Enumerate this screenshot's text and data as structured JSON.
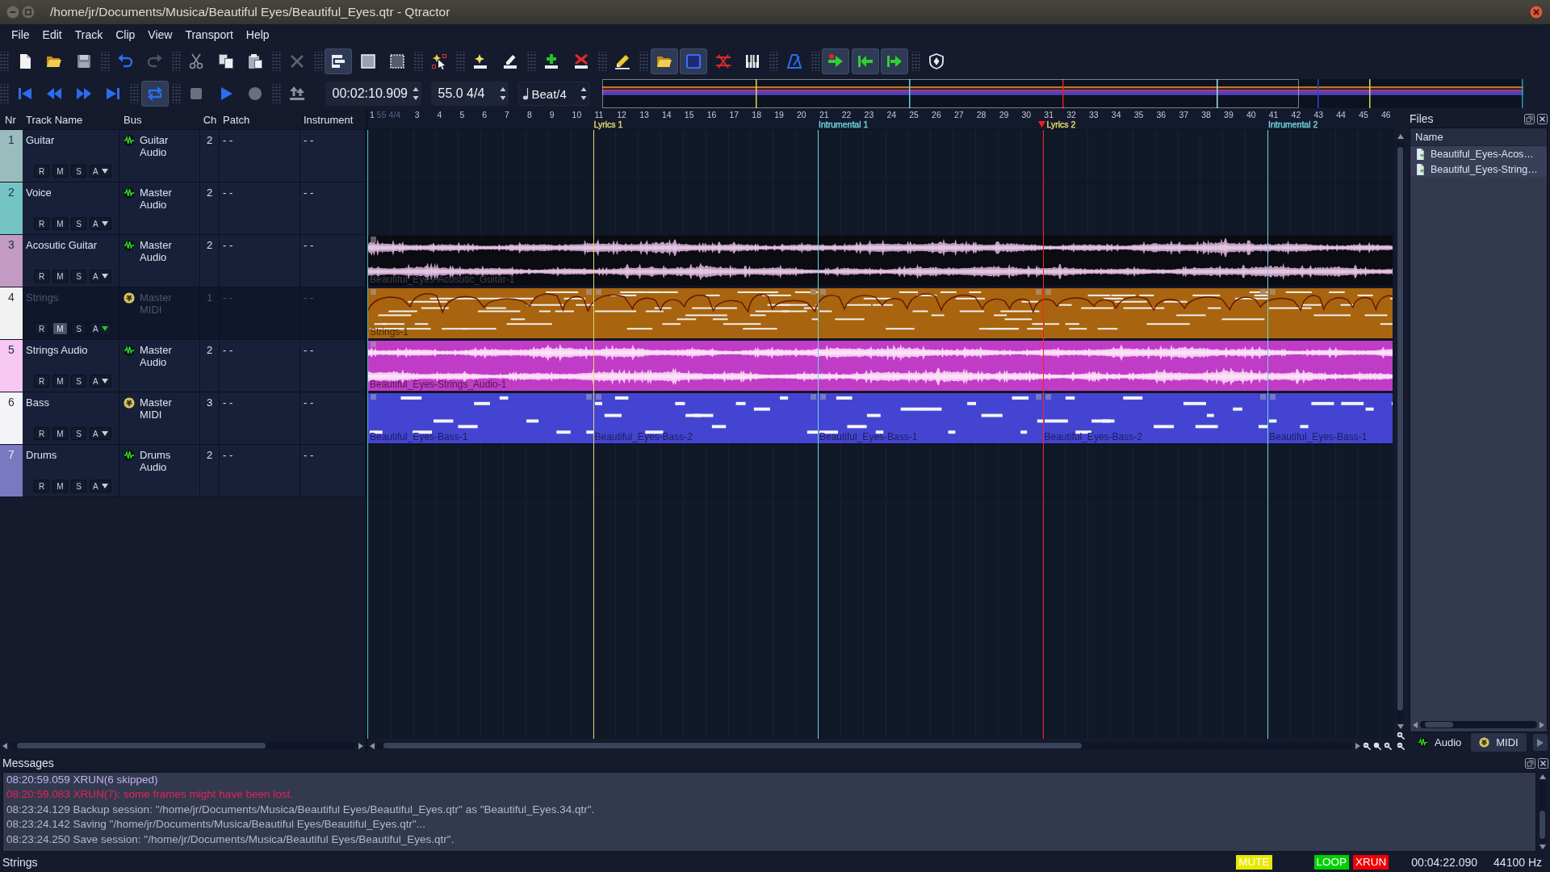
{
  "window": {
    "title": "/home/jr/Documents/Musica/Beautiful Eyes/Beautiful_Eyes.qtr - Qtractor"
  },
  "menu": [
    "File",
    "Edit",
    "Track",
    "Clip",
    "View",
    "Transport",
    "Help"
  ],
  "toolbar": [
    [
      {
        "kind": "new",
        "on": false
      },
      {
        "kind": "open",
        "on": false
      },
      {
        "kind": "save",
        "on": false
      }
    ],
    [
      {
        "kind": "undo",
        "on": false
      },
      {
        "kind": "redo",
        "on": false
      }
    ],
    [
      {
        "kind": "cut",
        "on": false
      },
      {
        "kind": "copy",
        "on": false
      },
      {
        "kind": "paste",
        "on": false
      }
    ],
    [
      {
        "kind": "delete",
        "on": false
      }
    ],
    [
      {
        "kind": "track_view",
        "on": true
      },
      {
        "kind": "select_clip",
        "on": false
      },
      {
        "kind": "select_range",
        "on": false
      }
    ],
    [
      {
        "kind": "select_tool",
        "on": false
      }
    ],
    [
      {
        "kind": "add_track",
        "on": false
      },
      {
        "kind": "edit_track",
        "on": false
      }
    ],
    [
      {
        "kind": "add_clip",
        "on": false
      },
      {
        "kind": "remove_clip",
        "on": false
      }
    ],
    [
      {
        "kind": "pencil",
        "on": false
      }
    ],
    [
      {
        "kind": "files",
        "on": true
      },
      {
        "kind": "connections",
        "on": true
      },
      {
        "kind": "crossed",
        "on": false
      },
      {
        "kind": "keys",
        "on": false
      }
    ],
    [
      {
        "kind": "metronome",
        "on": false
      }
    ],
    [
      {
        "kind": "follow",
        "on": true
      },
      {
        "kind": "punch_in",
        "on": true
      },
      {
        "kind": "punch_out",
        "on": true
      }
    ],
    [
      {
        "kind": "shield",
        "on": false
      }
    ]
  ],
  "transport": {
    "buttons": [
      [
        {
          "kind": "first",
          "on": false
        },
        {
          "kind": "rewind",
          "on": false
        },
        {
          "kind": "forward",
          "on": false
        },
        {
          "kind": "last",
          "on": false
        }
      ],
      [
        {
          "kind": "loop",
          "on": true
        }
      ],
      [
        {
          "kind": "stop",
          "on": false
        },
        {
          "kind": "play",
          "on": false
        },
        {
          "kind": "record",
          "on": false
        }
      ],
      [
        {
          "kind": "punch",
          "on": false
        }
      ]
    ],
    "time": "00:02:10.909",
    "tempo": "55.0 4/4",
    "snap": "Beat/4"
  },
  "track_list": {
    "columns": [
      "Nr",
      "Track Name",
      "Bus",
      "Ch",
      "Patch",
      "Instrument"
    ],
    "tracks": [
      {
        "nr": "1",
        "name": "Guitar",
        "color": "#9bbcbc",
        "selected": false,
        "buttons": [
          "R",
          "M",
          "S",
          "A"
        ],
        "muted": false,
        "automation": false,
        "bus": {
          "kind": "audio",
          "label": "Guitar Audio"
        },
        "ch": "2",
        "patch": "- -",
        "instrument": "- -"
      },
      {
        "nr": "2",
        "name": "Voice",
        "color": "#74c4c4",
        "selected": false,
        "buttons": [
          "R",
          "M",
          "S",
          "A"
        ],
        "muted": false,
        "automation": false,
        "bus": {
          "kind": "audio",
          "label": "Master Audio"
        },
        "ch": "2",
        "patch": "- -",
        "instrument": "- -"
      },
      {
        "nr": "3",
        "name": "Acosutic Guitar",
        "color": "#c29ac2",
        "selected": false,
        "buttons": [
          "R",
          "M",
          "S",
          "A"
        ],
        "muted": false,
        "automation": false,
        "bus": {
          "kind": "audio",
          "label": "Master Audio"
        },
        "ch": "2",
        "patch": "- -",
        "instrument": "- -",
        "clips": [
          {
            "kind": "audio",
            "color": "#0b0b12",
            "label": "Beautiful_Eyes-Acosutic_Guitar-1"
          }
        ]
      },
      {
        "nr": "4",
        "name": "Strings",
        "color": "#f2f2f2",
        "selected": true,
        "buttons": [
          "R",
          "M",
          "S",
          "A"
        ],
        "muted": true,
        "automation": true,
        "bus": {
          "kind": "midi",
          "label": "Master MIDI"
        },
        "ch": "1",
        "patch": "- -",
        "instrument": "- -",
        "clips": [
          {
            "kind": "midi",
            "color": "#a8640e",
            "label": "Strings-1"
          },
          {
            "kind": "midi",
            "color": "#a8640e"
          },
          {
            "kind": "midi",
            "color": "#a8640e"
          },
          {
            "kind": "midi",
            "color": "#a8640e"
          },
          {
            "kind": "midi",
            "color": "#a8640e"
          }
        ]
      },
      {
        "nr": "5",
        "name": "Strings Audio",
        "color": "#f6c8f2",
        "selected": false,
        "buttons": [
          "R",
          "M",
          "S",
          "A"
        ],
        "muted": false,
        "automation": false,
        "bus": {
          "kind": "audio",
          "label": "Master Audio"
        },
        "ch": "2",
        "patch": "- -",
        "instrument": "- -",
        "clips": [
          {
            "kind": "audio",
            "color": "#c03cc6",
            "label": "Beautiful_Eyes-Strings_Audio-1"
          }
        ]
      },
      {
        "nr": "6",
        "name": "Bass",
        "color": "#f4f4f8",
        "selected": false,
        "buttons": [
          "R",
          "M",
          "S",
          "A"
        ],
        "muted": false,
        "automation": false,
        "bus": {
          "kind": "midi",
          "label": "Master MIDI"
        },
        "ch": "3",
        "patch": "- -",
        "instrument": "- -",
        "clips": [
          {
            "kind": "midi",
            "color": "#4444d2",
            "label": "Beautiful_Eyes-Bass-1"
          },
          {
            "kind": "midi",
            "color": "#4444d2",
            "label": "Beautiful_Eyes-Bass-2"
          },
          {
            "kind": "midi",
            "color": "#4444d2",
            "label": "Beautiful_Eyes-Bass-1"
          },
          {
            "kind": "midi",
            "color": "#4444d2",
            "label": "Beautiful_Eyes-Bass-2"
          },
          {
            "kind": "midi",
            "color": "#4444d2",
            "label": "Beautiful_Eyes-Bass-1"
          }
        ]
      },
      {
        "nr": "7",
        "name": "Drums",
        "color": "#7a78c0",
        "selected": false,
        "buttons": [
          "R",
          "M",
          "S",
          "A"
        ],
        "muted": false,
        "automation": false,
        "bus": {
          "kind": "audio",
          "label": "Drums Audio"
        },
        "ch": "2",
        "patch": "- -",
        "instrument": "- -"
      }
    ]
  },
  "timeline": {
    "ruler": [
      {
        "kind": "bar",
        "label": "1"
      },
      {
        "kind": "tempo",
        "label": "55 4/4"
      },
      {
        "kind": "bar",
        "label": "3"
      },
      {
        "kind": "bar",
        "label": "4"
      },
      {
        "kind": "bar",
        "label": "5"
      },
      {
        "kind": "bar",
        "label": "6"
      },
      {
        "kind": "bar",
        "label": "7"
      },
      {
        "kind": "bar",
        "label": "8"
      },
      {
        "kind": "bar",
        "label": "9"
      },
      {
        "kind": "bar",
        "label": "10"
      },
      {
        "kind": "bar",
        "label": "11",
        "marker": {
          "label": "Lyrics 1",
          "color": "#e2d86a",
          "playhead": false
        }
      },
      {
        "kind": "bar",
        "label": "12"
      },
      {
        "kind": "bar",
        "label": "13"
      },
      {
        "kind": "bar",
        "label": "14"
      },
      {
        "kind": "bar",
        "label": "15"
      },
      {
        "kind": "bar",
        "label": "16"
      },
      {
        "kind": "bar",
        "label": "17"
      },
      {
        "kind": "bar",
        "label": "18"
      },
      {
        "kind": "bar",
        "label": "19"
      },
      {
        "kind": "bar",
        "label": "20"
      },
      {
        "kind": "bar",
        "label": "21",
        "marker": {
          "label": "Intrumental 1",
          "color": "#6fd3dd",
          "playhead": false
        }
      },
      {
        "kind": "bar",
        "label": "22"
      },
      {
        "kind": "bar",
        "label": "23"
      },
      {
        "kind": "bar",
        "label": "24"
      },
      {
        "kind": "bar",
        "label": "25"
      },
      {
        "kind": "bar",
        "label": "26"
      },
      {
        "kind": "bar",
        "label": "27"
      },
      {
        "kind": "bar",
        "label": "28"
      },
      {
        "kind": "bar",
        "label": "29"
      },
      {
        "kind": "bar",
        "label": "30"
      },
      {
        "kind": "bar",
        "label": "31",
        "marker": {
          "label": "Lyrics 2",
          "color": "#e2d86a",
          "playhead": true
        }
      },
      {
        "kind": "bar",
        "label": "32"
      },
      {
        "kind": "bar",
        "label": "33"
      },
      {
        "kind": "bar",
        "label": "34"
      },
      {
        "kind": "bar",
        "label": "35"
      },
      {
        "kind": "bar",
        "label": "36"
      },
      {
        "kind": "bar",
        "label": "37"
      },
      {
        "kind": "bar",
        "label": "38"
      },
      {
        "kind": "bar",
        "label": "39"
      },
      {
        "kind": "bar",
        "label": "40"
      },
      {
        "kind": "bar",
        "label": "41",
        "marker": {
          "label": "Intrumental 2",
          "color": "#6fd3dd",
          "playhead": false
        }
      },
      {
        "kind": "bar",
        "label": "42"
      },
      {
        "kind": "bar",
        "label": "43"
      },
      {
        "kind": "bar",
        "label": "44"
      },
      {
        "kind": "bar",
        "label": "45"
      },
      {
        "kind": "bar",
        "label": "46"
      }
    ]
  },
  "files": {
    "title": "Files",
    "column": "Name",
    "items": [
      "Beautiful_Eyes-Acos…",
      "Beautiful_Eyes-String…"
    ],
    "tabs": [
      {
        "kind": "audio",
        "label": "Audio",
        "selected": true
      },
      {
        "kind": "midi",
        "label": "MIDI",
        "selected": false
      }
    ]
  },
  "messages": {
    "title": "Messages",
    "lines": [
      {
        "text": "08:20:59.059 XRUN(6 skipped)",
        "color": "#c4aef0"
      },
      {
        "text": "08:20:59.083 XRUN(7): some frames might have been lost.",
        "color": "#e8205a"
      },
      {
        "text": "08:23:24.129 Backup session: \"/home/jr/Documents/Musica/Beautiful Eyes/Beautiful_Eyes.qtr\" as \"Beautiful_Eyes.34.qtr\".",
        "color": "#b4b8c6"
      },
      {
        "text": "08:23:24.142 Saving \"/home/jr/Documents/Musica/Beautiful Eyes/Beautiful_Eyes.qtr\"...",
        "color": "#b4b8c6"
      },
      {
        "text": "08:23:24.250 Save session: \"/home/jr/Documents/Musica/Beautiful Eyes/Beautiful_Eyes.qtr\".",
        "color": "#b4b8c6"
      }
    ]
  },
  "status_bar": {
    "text": "Strings",
    "indicators": [
      {
        "label": "MUTE",
        "color": "#e8e800"
      },
      {
        "label": "LOOP",
        "color": "#00d000"
      },
      {
        "label": "XRUN",
        "color": "#f00000"
      }
    ],
    "time": "00:04:22.090",
    "rate": "44100 Hz"
  }
}
